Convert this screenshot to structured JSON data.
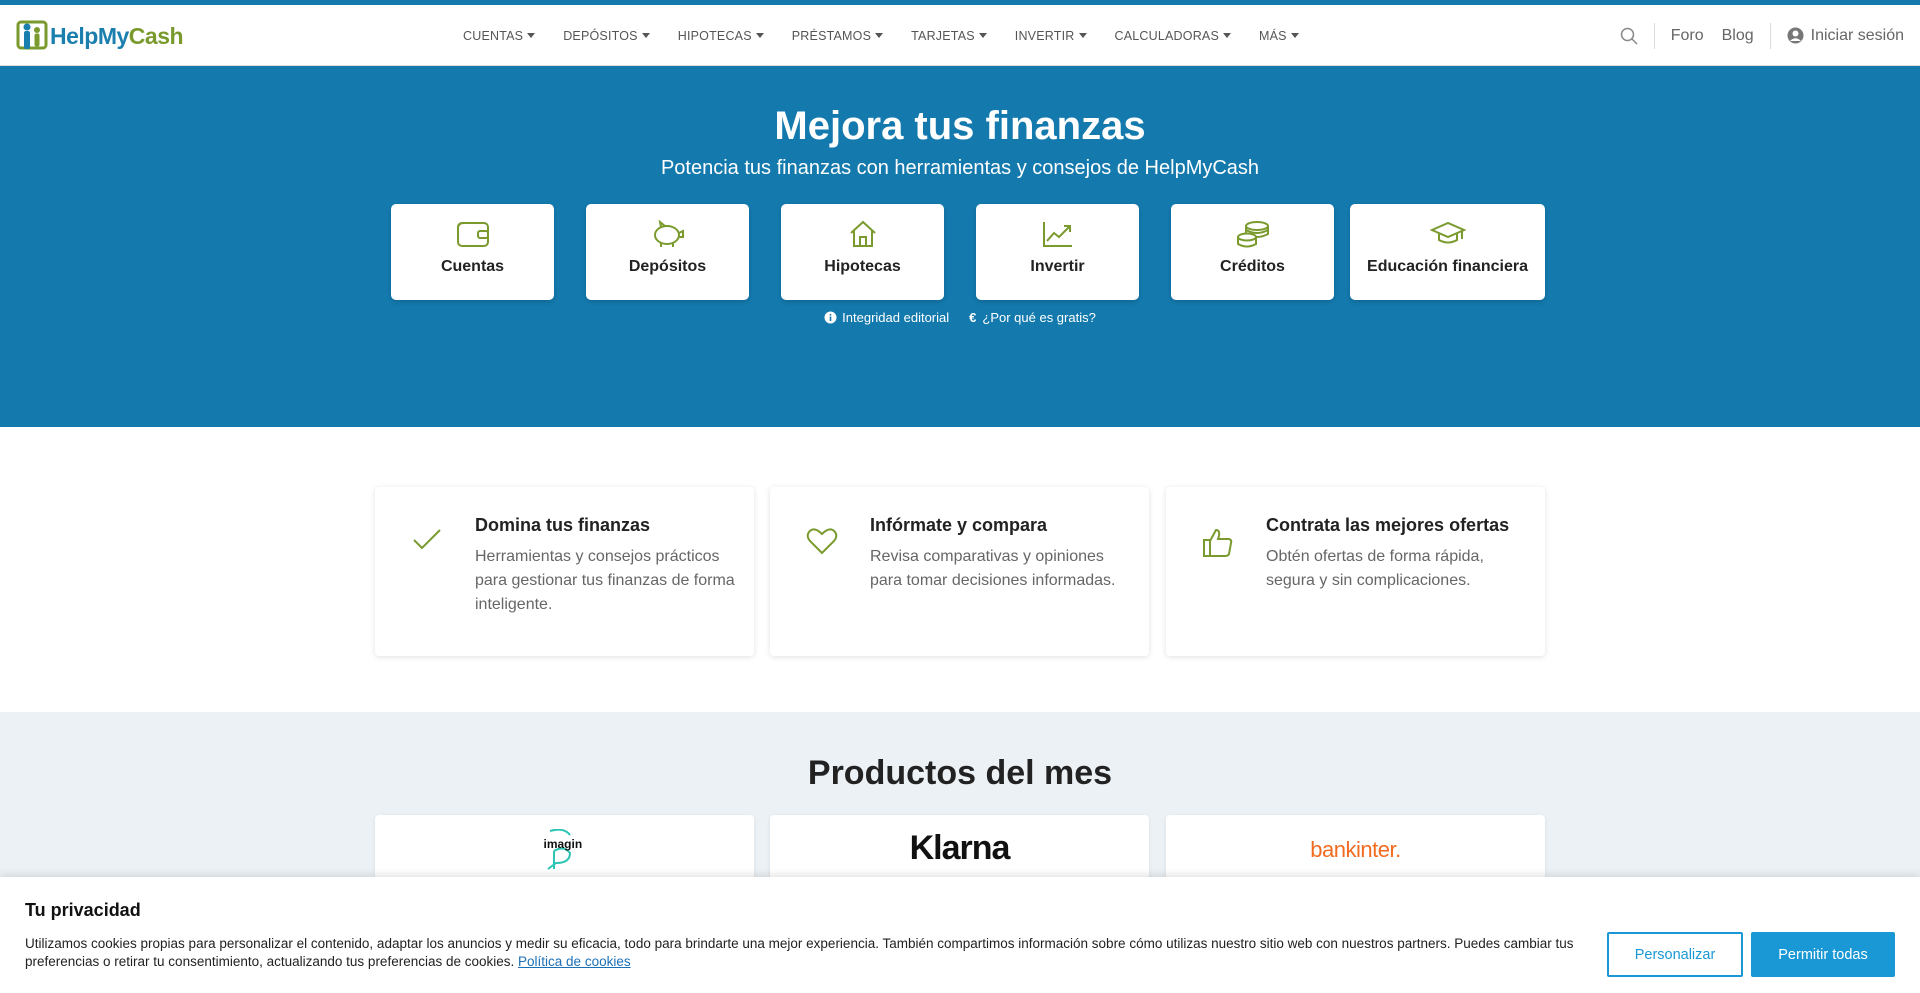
{
  "brand": {
    "logo_text_1": "HelpMy",
    "logo_text_2": "Cash"
  },
  "nav": {
    "items": [
      {
        "label": "CUENTAS"
      },
      {
        "label": "DEPÓSITOS"
      },
      {
        "label": "HIPOTECAS"
      },
      {
        "label": "PRÉSTAMOS"
      },
      {
        "label": "TARJETAS"
      },
      {
        "label": "INVERTIR"
      },
      {
        "label": "CALCULADORAS"
      },
      {
        "label": "MÁS"
      }
    ],
    "foro": "Foro",
    "blog": "Blog",
    "login": "Iniciar sesión"
  },
  "hero": {
    "title": "Mejora tus finanzas",
    "subtitle": "Potencia tus finanzas con herramientas y consejos de HelpMyCash",
    "categories": [
      {
        "label": "Cuentas",
        "icon": "wallet-icon"
      },
      {
        "label": "Depósitos",
        "icon": "piggy-bank-icon"
      },
      {
        "label": "Hipotecas",
        "icon": "house-icon"
      },
      {
        "label": "Invertir",
        "icon": "trending-up-icon"
      },
      {
        "label": "Créditos",
        "icon": "coins-icon"
      },
      {
        "label": "Educación financiera",
        "icon": "graduation-cap-icon"
      }
    ],
    "link_integrity": "Integridad editorial",
    "link_free": "¿Por qué es gratis?"
  },
  "features": [
    {
      "title": "Domina tus finanzas",
      "text": "Herramientas y consejos prácticos para gestionar tus finanzas de forma inteligente.",
      "icon": "check-icon"
    },
    {
      "title": "Infórmate y compara",
      "text": "Revisa comparativas y opiniones para tomar decisiones informadas.",
      "icon": "heart-icon"
    },
    {
      "title": "Contrata las mejores ofertas",
      "text": "Obtén ofertas de forma rápida, segura y sin complicaciones.",
      "icon": "thumbs-up-icon"
    }
  ],
  "products": {
    "title": "Productos del mes",
    "items": [
      {
        "brand": "imagin"
      },
      {
        "brand": "Klarna"
      },
      {
        "brand": "bankinter."
      }
    ]
  },
  "cookie": {
    "title": "Tu privacidad",
    "text": "Utilizamos cookies propias para personalizar el contenido, adaptar los anuncios y medir su eficacia, todo para brindarte una mejor experiencia. También compartimos información sobre cómo utilizas nuestro sitio web con nuestros partners. Puedes cambiar tus preferencias o retirar tu consentimiento, actualizando tus preferencias de cookies.",
    "policy_link": "Política de cookies",
    "customize": "Personalizar",
    "allow_all": "Permitir todas"
  },
  "colors": {
    "primary": "#1479ad",
    "accent_green": "#7a9a2e",
    "button_blue": "#1a98d5"
  }
}
